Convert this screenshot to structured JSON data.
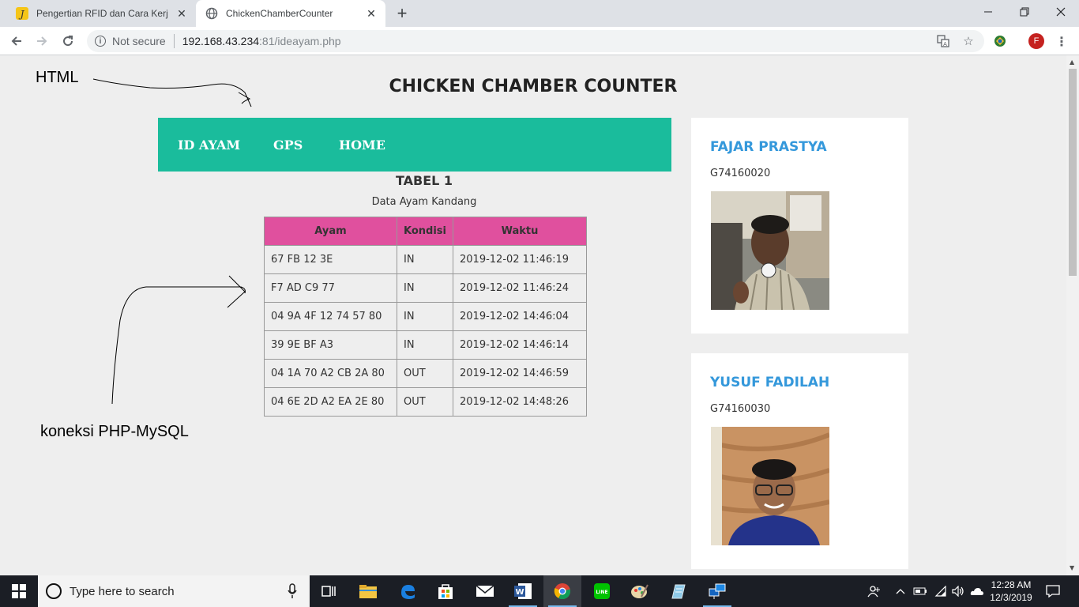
{
  "browser": {
    "tabs": [
      {
        "title": "Pengertian RFID dan Cara Kerjanya",
        "favicon": "yellow-j-icon"
      },
      {
        "title": "ChickenChamberCounter",
        "favicon": "globe-icon"
      }
    ],
    "new_tab": "+",
    "address": {
      "security": "Not secure",
      "host": "192.168.43.234",
      "rest": ":81/ideayam.php"
    },
    "profile_initial": "F"
  },
  "page": {
    "title": "CHICKEN CHAMBER COUNTER",
    "nav": [
      {
        "label": "ID AYAM"
      },
      {
        "label": "GPS"
      },
      {
        "label": "HOME"
      }
    ],
    "table_title": "TABEL 1",
    "table_caption": "Data Ayam Kandang",
    "table": {
      "headers": [
        "Ayam",
        "Kondisi",
        "Waktu"
      ],
      "rows": [
        [
          "67 FB 12 3E",
          "IN",
          "2019-12-02 11:46:19"
        ],
        [
          "F7 AD C9 77",
          "IN",
          "2019-12-02 11:46:24"
        ],
        [
          "04 9A 4F 12 74 57 80",
          "IN",
          "2019-12-02 14:46:04"
        ],
        [
          "39 9E BF A3",
          "IN",
          "2019-12-02 14:46:14"
        ],
        [
          "04 1A 70 A2 CB 2A 80",
          "OUT",
          "2019-12-02 14:46:59"
        ],
        [
          "04 6E 2D A2 EA 2E 80",
          "OUT",
          "2019-12-02 14:48:26"
        ]
      ]
    },
    "profiles": [
      {
        "name": "FAJAR PRASTYA",
        "id": "G74160020"
      },
      {
        "name": "YUSUF FADILAH",
        "id": "G74160030"
      }
    ],
    "colors": {
      "nav_bg": "#1abc9c",
      "table_header_bg": "#e0509e",
      "profile_name": "#3498db"
    }
  },
  "annotations": {
    "html_label": "HTML",
    "php_label": "koneksi PHP-MySQL"
  },
  "taskbar": {
    "search_placeholder": "Type here to search",
    "time": "12:28 AM",
    "date": "12/3/2019"
  }
}
